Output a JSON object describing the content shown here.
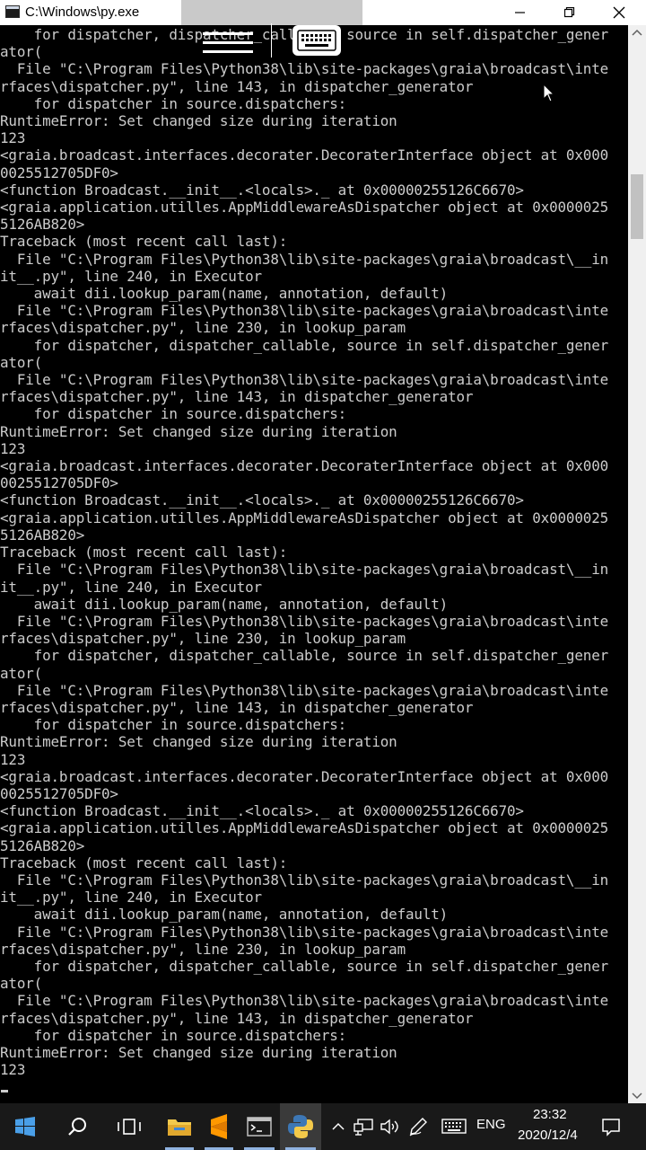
{
  "window": {
    "title": "C:\\Windows\\py.exe",
    "icon": "console-window-icon"
  },
  "console": {
    "lines": [
      "    for dispatcher, dispatcher_callable, source in self.dispatcher_gener",
      "ator(",
      "  File \"C:\\Program Files\\Python38\\lib\\site-packages\\graia\\broadcast\\inte",
      "rfaces\\dispatcher.py\", line 143, in dispatcher_generator",
      "    for dispatcher in source.dispatchers:",
      "RuntimeError: Set changed size during iteration",
      "123",
      "<graia.broadcast.interfaces.decorater.DecoraterInterface object at 0x000",
      "0025512705DF0>",
      "<function Broadcast.__init__.<locals>._ at 0x00000255126C6670>",
      "<graia.application.utilles.AppMiddlewareAsDispatcher object at 0x0000025",
      "5126AB820>",
      "Traceback (most recent call last):",
      "  File \"C:\\Program Files\\Python38\\lib\\site-packages\\graia\\broadcast\\__in",
      "it__.py\", line 240, in Executor",
      "    await dii.lookup_param(name, annotation, default)",
      "  File \"C:\\Program Files\\Python38\\lib\\site-packages\\graia\\broadcast\\inte",
      "rfaces\\dispatcher.py\", line 230, in lookup_param",
      "    for dispatcher, dispatcher_callable, source in self.dispatcher_gener",
      "ator(",
      "  File \"C:\\Program Files\\Python38\\lib\\site-packages\\graia\\broadcast\\inte",
      "rfaces\\dispatcher.py\", line 143, in dispatcher_generator",
      "    for dispatcher in source.dispatchers:",
      "RuntimeError: Set changed size during iteration",
      "123",
      "<graia.broadcast.interfaces.decorater.DecoraterInterface object at 0x000",
      "0025512705DF0>",
      "<function Broadcast.__init__.<locals>._ at 0x00000255126C6670>",
      "<graia.application.utilles.AppMiddlewareAsDispatcher object at 0x0000025",
      "5126AB820>",
      "Traceback (most recent call last):",
      "  File \"C:\\Program Files\\Python38\\lib\\site-packages\\graia\\broadcast\\__in",
      "it__.py\", line 240, in Executor",
      "    await dii.lookup_param(name, annotation, default)",
      "  File \"C:\\Program Files\\Python38\\lib\\site-packages\\graia\\broadcast\\inte",
      "rfaces\\dispatcher.py\", line 230, in lookup_param",
      "    for dispatcher, dispatcher_callable, source in self.dispatcher_gener",
      "ator(",
      "  File \"C:\\Program Files\\Python38\\lib\\site-packages\\graia\\broadcast\\inte",
      "rfaces\\dispatcher.py\", line 143, in dispatcher_generator",
      "    for dispatcher in source.dispatchers:",
      "RuntimeError: Set changed size during iteration",
      "123",
      "<graia.broadcast.interfaces.decorater.DecoraterInterface object at 0x000",
      "0025512705DF0>",
      "<function Broadcast.__init__.<locals>._ at 0x00000255126C6670>",
      "<graia.application.utilles.AppMiddlewareAsDispatcher object at 0x0000025",
      "5126AB820>",
      "Traceback (most recent call last):",
      "  File \"C:\\Program Files\\Python38\\lib\\site-packages\\graia\\broadcast\\__in",
      "it__.py\", line 240, in Executor",
      "    await dii.lookup_param(name, annotation, default)",
      "  File \"C:\\Program Files\\Python38\\lib\\site-packages\\graia\\broadcast\\inte",
      "rfaces\\dispatcher.py\", line 230, in lookup_param",
      "    for dispatcher, dispatcher_callable, source in self.dispatcher_gener",
      "ator(",
      "  File \"C:\\Program Files\\Python38\\lib\\site-packages\\graia\\broadcast\\inte",
      "rfaces\\dispatcher.py\", line 143, in dispatcher_generator",
      "    for dispatcher in source.dispatchers:",
      "RuntimeError: Set changed size during iteration",
      "123"
    ]
  },
  "taskbar": {
    "apps": [
      {
        "name": "start-button",
        "icon": "windows-logo-icon"
      },
      {
        "name": "search-button",
        "icon": "search-icon"
      },
      {
        "name": "task-view-button",
        "icon": "task-view-icon"
      },
      {
        "name": "file-explorer-button",
        "icon": "folder-icon"
      },
      {
        "name": "sublime-text-button",
        "icon": "sublime-text-icon"
      },
      {
        "name": "terminal-button",
        "icon": "terminal-icon"
      },
      {
        "name": "python-button",
        "icon": "python-icon"
      }
    ],
    "tray": {
      "language": "ENG",
      "time": "23:32",
      "date": "2020/12/4"
    }
  },
  "colors": {
    "console_bg": "#000000",
    "console_text": "#cccccc",
    "taskbar_bg": "#191919",
    "accent": "#8fb2e0"
  }
}
